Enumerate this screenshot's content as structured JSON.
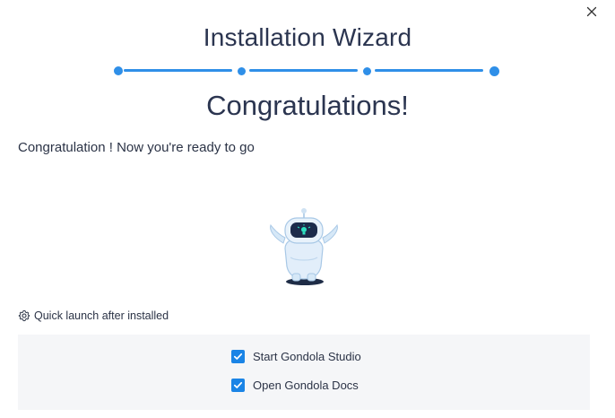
{
  "window": {
    "title": "Installation Wizard",
    "close_icon": "close-icon"
  },
  "steps": {
    "count": 4,
    "current": 4,
    "color": "#2f8fe8"
  },
  "content": {
    "heading": "Congratulations!",
    "message": "Congratulation ! Now you're ready to go",
    "illustration": "robot-mascot"
  },
  "quick_launch": {
    "label": "Quick launch after installed",
    "icon": "gear-icon",
    "options": [
      {
        "label": "Start Gondola Studio",
        "checked": true
      },
      {
        "label": "Open Gondola Docs",
        "checked": true
      }
    ]
  },
  "colors": {
    "accent": "#1a84e6",
    "title_text": "#2b3550",
    "panel_bg": "#f5f6f8"
  }
}
